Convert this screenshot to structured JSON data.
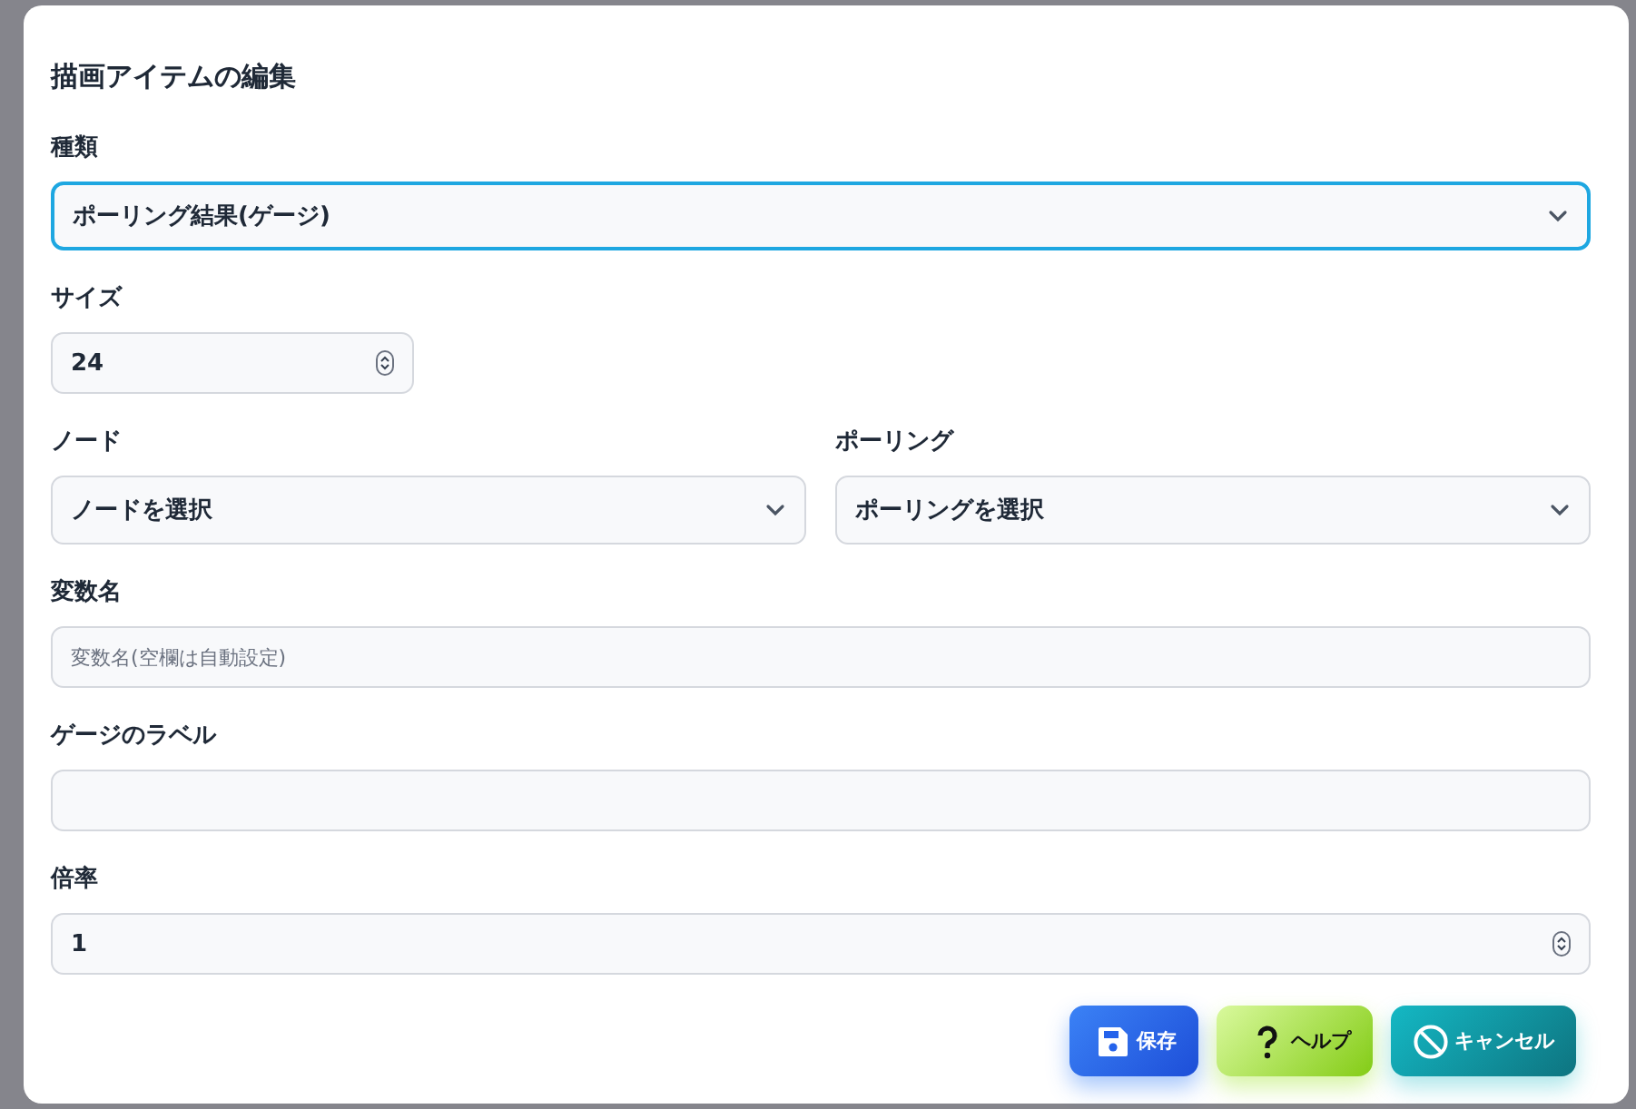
{
  "dialog": {
    "title": "描画アイテムの編集"
  },
  "rows": [
    {
      "kind": "full",
      "fields": [
        {
          "kind": "select",
          "label": "種類",
          "value": "ポーリング結果(ゲージ)",
          "focused": true
        }
      ]
    },
    {
      "kind": "short",
      "fields": [
        {
          "kind": "number",
          "label": "サイズ",
          "value": "24",
          "focused": false
        }
      ]
    },
    {
      "kind": "half",
      "fields": [
        {
          "kind": "select",
          "label": "ノード",
          "value": "ノードを選択",
          "focused": false
        },
        {
          "kind": "select",
          "label": "ポーリング",
          "value": "ポーリングを選択",
          "focused": false
        }
      ]
    },
    {
      "kind": "full",
      "fields": [
        {
          "kind": "text",
          "label": "変数名",
          "placeholder": "変数名(空欄は自動設定)",
          "focused": false
        }
      ]
    },
    {
      "kind": "full",
      "fields": [
        {
          "kind": "text",
          "label": "ゲージのラベル",
          "focused": false
        }
      ]
    },
    {
      "kind": "full",
      "fields": [
        {
          "kind": "number",
          "label": "倍率",
          "value": "1",
          "focused": false
        }
      ]
    }
  ],
  "buttons": [
    {
      "kind": "save",
      "label": "保存"
    },
    {
      "kind": "help",
      "label": "ヘルプ"
    },
    {
      "kind": "cancel",
      "label": "キャンセル"
    }
  ]
}
